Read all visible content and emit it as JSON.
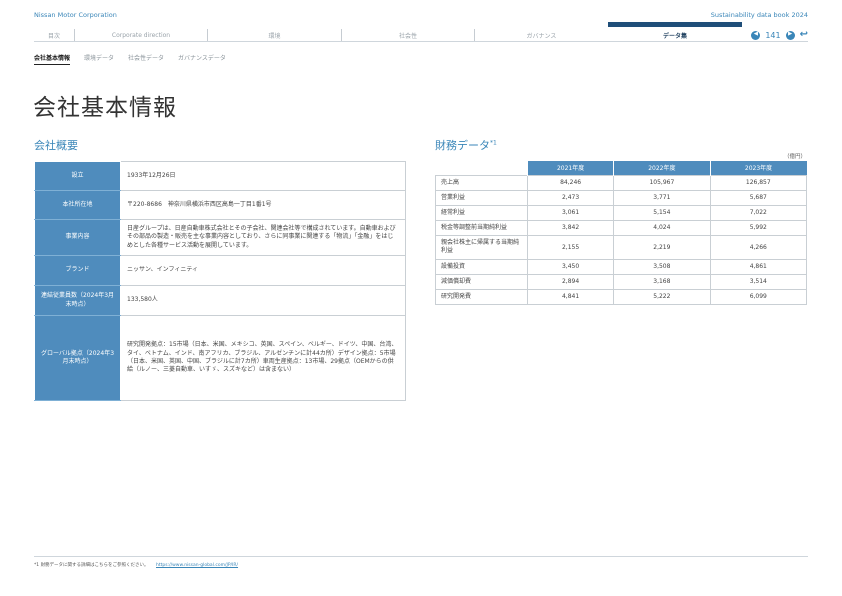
{
  "header": {
    "company": "Nissan Motor Corporation",
    "book_title": "Sustainability data book 2024"
  },
  "nav": {
    "tabs": [
      "目次",
      "Corporate direction",
      "環境",
      "社会性",
      "ガバナンス",
      "データ集"
    ],
    "active_tab": "データ集",
    "page_number": "141"
  },
  "subnav": {
    "items": [
      "会社基本情報",
      "環境データ",
      "社会性データ",
      "ガバナンスデータ"
    ],
    "active": "会社基本情報"
  },
  "page_title": "会社基本情報",
  "overview": {
    "title": "会社概要",
    "rows": [
      {
        "label": "設立",
        "value": "1933年12月26日"
      },
      {
        "label": "本社所在地",
        "value": "〒220-8686　神奈川県横浜市西区高島一丁目1番1号"
      },
      {
        "label": "事業内容",
        "value": "日産グループは、日産自動車株式会社とその子会社、関連会社等で構成されています。自動車およびその部品の製造・販売を主な事業内容としており、さらに同事業に関連する「物流」「金融」をはじめとした各種サービス活動を展開しています。"
      },
      {
        "label": "ブランド",
        "value": "ニッサン、インフィニティ"
      },
      {
        "label": "連結従業員数（2024年3月末時点）",
        "value": "133,580人"
      },
      {
        "label": "グローバル拠点（2024年3月末時点）",
        "value": "研究開発拠点：15市場（日本、米国、メキシコ、英国、スペイン、ベルギー、ドイツ、中国、台湾、タイ、ベトナム、インド、南アフリカ、ブラジル、アルゼンチンに計44カ所）デザイン拠点：5市場（日本、米国、英国、中国、ブラジルに計7カ所）車両生産拠点：13市場、29拠点（OEMからの供給（ルノー、三菱自動車、いすゞ、スズキなど）は含まない）"
      }
    ]
  },
  "financial": {
    "title": "財務データ",
    "title_note": "*1",
    "unit": "（億円）",
    "years": [
      "2021年度",
      "2022年度",
      "2023年度"
    ],
    "rows": [
      {
        "label": "売上高",
        "values": [
          "84,246",
          "105,967",
          "126,857"
        ]
      },
      {
        "label": "営業利益",
        "values": [
          "2,473",
          "3,771",
          "5,687"
        ]
      },
      {
        "label": "経常利益",
        "values": [
          "3,061",
          "5,154",
          "7,022"
        ]
      },
      {
        "label": "税金等調整前当期純利益",
        "values": [
          "3,842",
          "4,024",
          "5,992"
        ]
      },
      {
        "label": "親会社株主に帰属する当期純利益",
        "values": [
          "2,155",
          "2,219",
          "4,266"
        ]
      },
      {
        "label": "設備投資",
        "values": [
          "3,450",
          "3,508",
          "4,861"
        ]
      },
      {
        "label": "減価償却費",
        "values": [
          "2,894",
          "3,168",
          "3,514"
        ]
      },
      {
        "label": "研究開発費",
        "values": [
          "4,841",
          "5,222",
          "6,099"
        ]
      }
    ]
  },
  "footnote": {
    "mark": "*1",
    "text": "財務データに関する詳細はこちらをご参照ください。",
    "link": "https://www.nissan-global.com/JP/IR/"
  }
}
